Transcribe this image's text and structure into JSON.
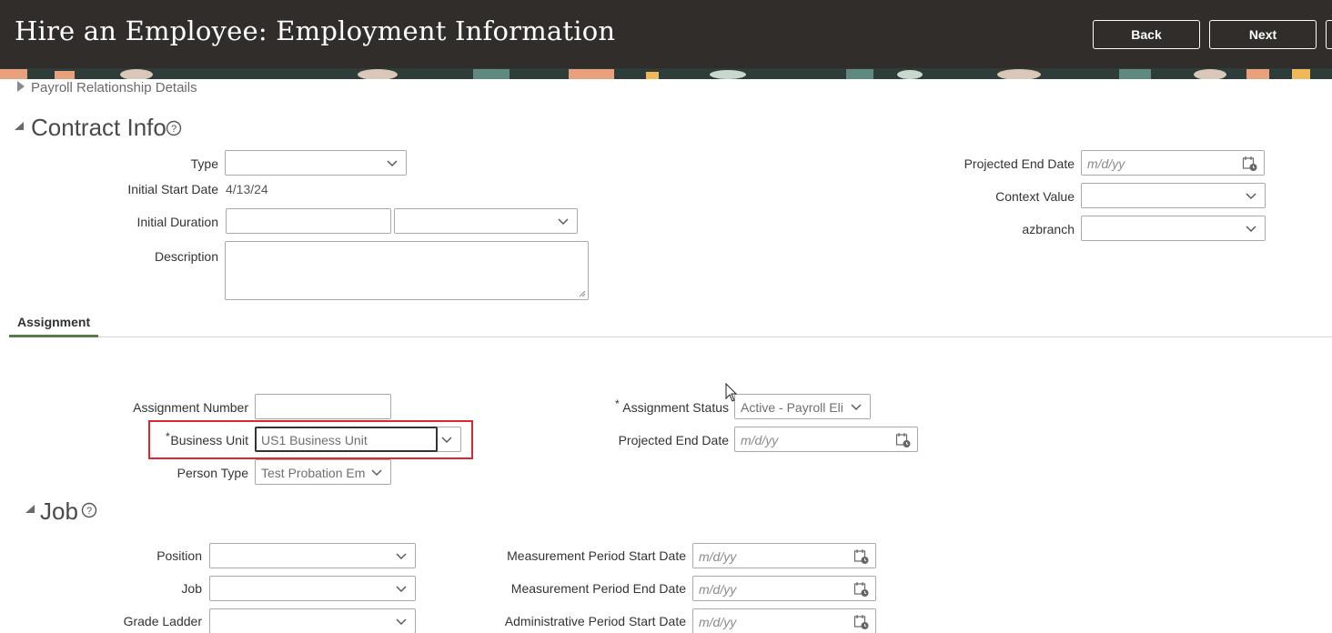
{
  "header": {
    "title": "Hire an Employee: Employment Information",
    "back_label": "Back",
    "next_label": "Next"
  },
  "payroll": {
    "label": "Payroll Relationship Details"
  },
  "contract": {
    "title": "Contract Info",
    "type_label": "Type",
    "type_value": "",
    "initial_start_label": "Initial Start Date",
    "initial_start_value": "4/13/24",
    "initial_duration_label": "Initial Duration",
    "initial_duration_value": "",
    "initial_duration_unit": "",
    "description_label": "Description",
    "description_value": "",
    "projected_end_label": "Projected End Date",
    "projected_end_placeholder": "m/d/yy",
    "context_value_label": "Context Value",
    "context_value": "",
    "azbranch_label": "azbranch",
    "azbranch_value": ""
  },
  "tabs": {
    "assignment_label": "Assignment"
  },
  "assignment": {
    "number_label": "Assignment Number",
    "number_value": "",
    "business_unit_label": "Business Unit",
    "business_unit_value": "US1 Business Unit",
    "person_type_label": "Person Type",
    "person_type_value": "Test Probation Em",
    "status_label": "Assignment Status",
    "status_value": "Active - Payroll Eli",
    "projected_end_label": "Projected End Date",
    "projected_end_placeholder": "m/d/yy",
    "required_mark": "*"
  },
  "job": {
    "title": "Job",
    "position_label": "Position",
    "position_value": "",
    "job_label": "Job",
    "job_value": "",
    "grade_ladder_label": "Grade Ladder",
    "grade_ladder_value": "",
    "mp_start_label": "Measurement Period Start Date",
    "mp_start_placeholder": "m/d/yy",
    "mp_end_label": "Measurement Period End Date",
    "mp_end_placeholder": "m/d/yy",
    "admin_start_label": "Administrative Period Start Date",
    "admin_start_placeholder": "m/d/yy"
  },
  "icons": {
    "help": "help-circle-icon",
    "calendar": "calendar-icon",
    "chevron": "chevron-down-icon",
    "disclosure": "disclosure-triangle-icon"
  },
  "colors": {
    "header_bg": "#312d2a",
    "tab_accent": "#5a7a4a",
    "highlight": "#e0252f"
  }
}
